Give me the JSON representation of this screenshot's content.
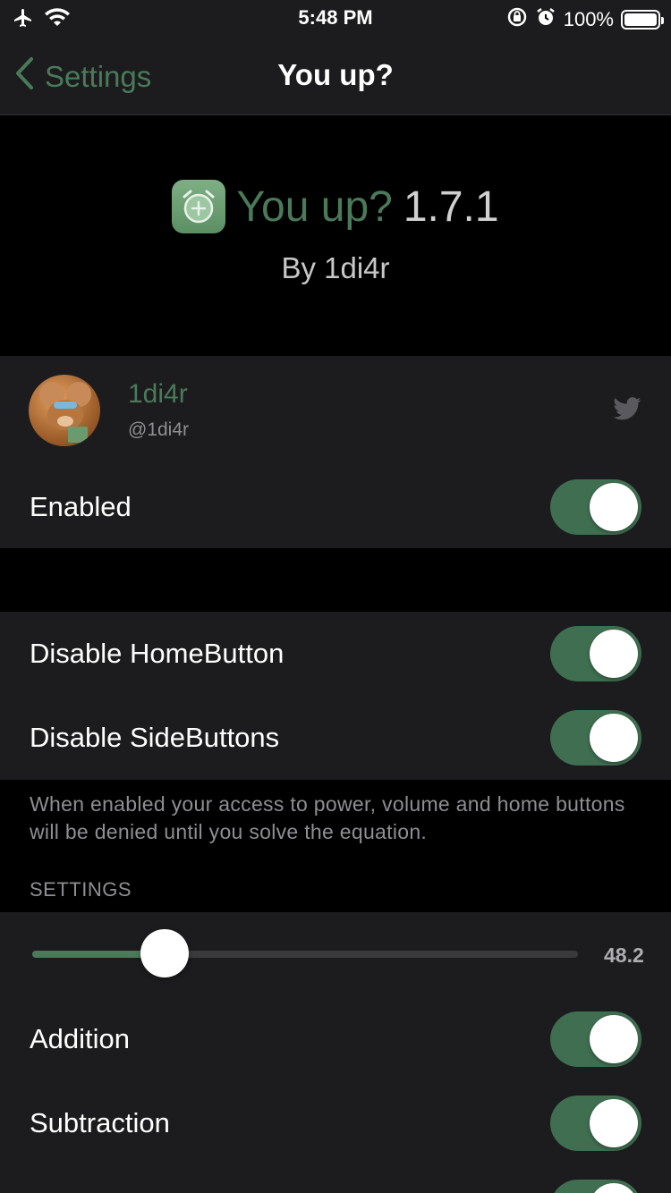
{
  "status_bar": {
    "time": "5:48 PM",
    "battery_text": "100%",
    "battery_level": 1.0,
    "icons": [
      "airplane-icon",
      "wifi-icon",
      "rotation-lock-icon",
      "alarm-icon",
      "battery-icon"
    ]
  },
  "nav": {
    "back_label": "Settings",
    "title": "You up?"
  },
  "banner": {
    "name": "You up?",
    "version": "1.7.1",
    "author": "By 1di4r",
    "icon": "alarm-clock-icon"
  },
  "developer": {
    "name": "1di4r",
    "handle": "@1di4r",
    "icon": "twitter-icon"
  },
  "enabled": {
    "label": "Enabled",
    "on": true
  },
  "disable_group": {
    "items": [
      {
        "label": "Disable HomeButton",
        "on": true
      },
      {
        "label": "Disable SideButtons",
        "on": true
      }
    ],
    "footer": "When enabled your access to power, volume and home buttons will be denied until you solve the equation."
  },
  "settings": {
    "header": "SETTINGS",
    "slider": {
      "value_text": "48.2",
      "fraction": 0.243
    },
    "items": [
      {
        "label": "Addition",
        "on": true
      },
      {
        "label": "Subtraction",
        "on": true
      }
    ]
  },
  "colors": {
    "accent": "#4a7a5a",
    "toggle_on": "#3f6e50",
    "group_bg": "#1c1c1e",
    "page_bg": "#000000",
    "secondary_text": "#8e8e93"
  }
}
